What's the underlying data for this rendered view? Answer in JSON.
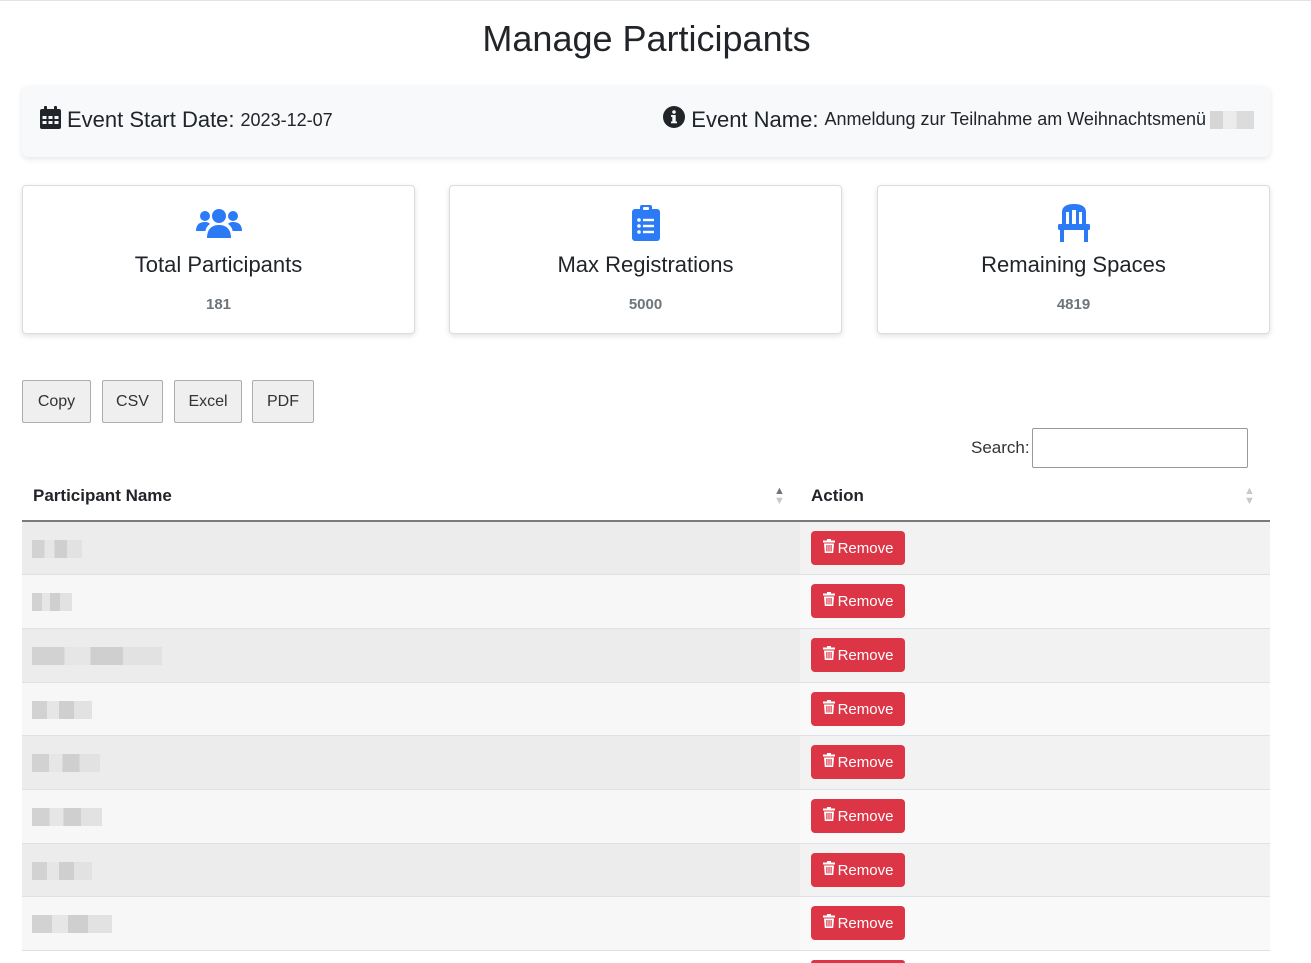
{
  "page": {
    "title": "Manage Participants"
  },
  "event": {
    "start_label": "Event Start Date:",
    "start_value": "2023-12-07",
    "name_label": "Event Name:",
    "name_value": "Anmeldung zur Teilnahme am Weihnachtsmenü"
  },
  "stats": [
    {
      "title": "Total Participants",
      "value": "181",
      "icon": "users-icon"
    },
    {
      "title": "Max Registrations",
      "value": "5000",
      "icon": "clipboard-list-icon"
    },
    {
      "title": "Remaining Spaces",
      "value": "4819",
      "icon": "chair-icon"
    }
  ],
  "exports": [
    "Copy",
    "CSV",
    "Excel",
    "PDF"
  ],
  "search": {
    "label": "Search:",
    "placeholder": ""
  },
  "table": {
    "headers": [
      "Participant Name",
      "Action"
    ],
    "remove_label": "Remove",
    "rows": [
      {
        "name": ""
      },
      {
        "name": ""
      },
      {
        "name": ""
      },
      {
        "name": ""
      },
      {
        "name": ""
      },
      {
        "name": ""
      },
      {
        "name": ""
      },
      {
        "name": ""
      }
    ]
  },
  "colors": {
    "accent": "#2b7bf6",
    "danger": "#dc3545",
    "muted": "#6c757d"
  }
}
